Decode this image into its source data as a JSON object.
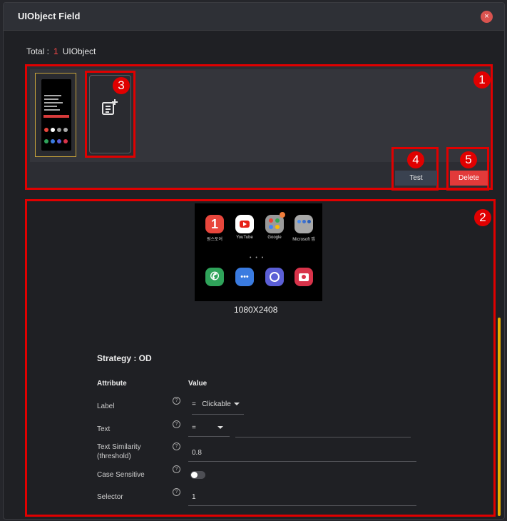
{
  "dialog": {
    "title": "UIObject Field",
    "close_label": "×"
  },
  "total": {
    "prefix": "Total :",
    "count": "1",
    "suffix": "UIObject"
  },
  "markers": {
    "m1": "1",
    "m2": "2",
    "m3": "3",
    "m4": "4",
    "m5": "5"
  },
  "actions": {
    "test_label": "Test",
    "delete_label": "Delete"
  },
  "preview": {
    "apps_row1": [
      {
        "label": "원스토어",
        "icon": "onestore-icon",
        "color": "#e8463c"
      },
      {
        "label": "YouTube",
        "icon": "youtube-icon",
        "color": "#ffffff"
      },
      {
        "label": "Google",
        "icon": "google-folder-icon",
        "color": "#9a9a9a"
      },
      {
        "label": "Microsoft 앱",
        "icon": "microsoft-folder-icon",
        "color": "#a8a8a8"
      }
    ],
    "apps_row2": [
      {
        "icon": "phone-icon",
        "color": "#2fa35a"
      },
      {
        "icon": "messages-icon",
        "color": "#3a7be0"
      },
      {
        "icon": "internet-icon",
        "color": "#5b5fd6"
      },
      {
        "icon": "camera-icon",
        "color": "#d8334a"
      }
    ],
    "page_dots": "• • •",
    "resolution": "1080X2408"
  },
  "form": {
    "strategy": "Strategy : OD",
    "attribute_header": "Attribute",
    "value_header": "Value",
    "label_row": {
      "label": "Label",
      "operator": "=",
      "value": "Clickable"
    },
    "text_row": {
      "label": "Text",
      "operator": "=",
      "value": ""
    },
    "similarity_row": {
      "label_line1": "Text Similarity",
      "label_line2": "(threshold)",
      "value": "0.8"
    },
    "case_row": {
      "label": "Case Sensitive",
      "enabled": false
    },
    "selector_row": {
      "label": "Selector",
      "value": "1"
    },
    "help_glyph": "?"
  }
}
